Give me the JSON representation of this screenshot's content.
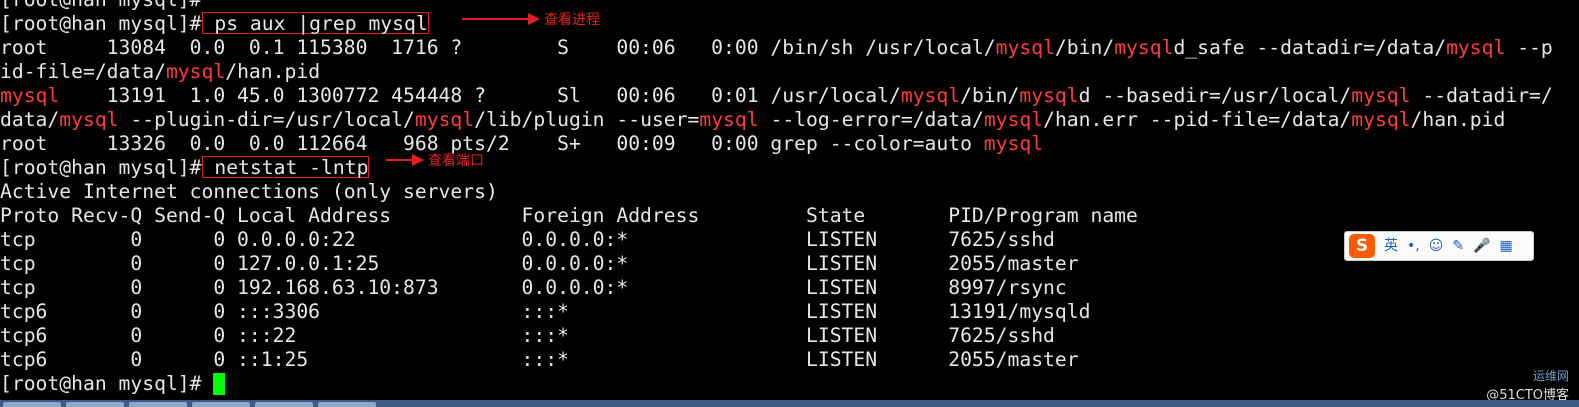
{
  "terminal": {
    "lines": [
      [
        {
          "t": "[root@han mysql]#",
          "c": ""
        }
      ],
      [
        {
          "t": "[root@han mysql]#",
          "c": ""
        },
        {
          "t": " ps aux |grep mysql",
          "c": "cmd"
        }
      ],
      [
        {
          "t": "root     13084  0.0  0.1 115380  1716 ?        S    00:06   0:00 /bin/sh /usr/local/",
          "c": ""
        },
        {
          "t": "mysql",
          "c": "red"
        },
        {
          "t": "/bin/",
          "c": ""
        },
        {
          "t": "mysql",
          "c": "red"
        },
        {
          "t": "d_safe --datadir=/data/",
          "c": ""
        },
        {
          "t": "mysql",
          "c": "red"
        },
        {
          "t": " --p",
          "c": ""
        }
      ],
      [
        {
          "t": "id-file=/data/",
          "c": ""
        },
        {
          "t": "mysql",
          "c": "red"
        },
        {
          "t": "/han.pid",
          "c": ""
        }
      ],
      [
        {
          "t": "mysql",
          "c": "red"
        },
        {
          "t": "    13191  1.0 45.0 1300772 454448 ?      Sl   00:06   0:01 /usr/local/",
          "c": ""
        },
        {
          "t": "mysql",
          "c": "red"
        },
        {
          "t": "/bin/",
          "c": ""
        },
        {
          "t": "mysql",
          "c": "red"
        },
        {
          "t": "d --basedir=/usr/local/",
          "c": ""
        },
        {
          "t": "mysql",
          "c": "red"
        },
        {
          "t": " --datadir=/",
          "c": ""
        }
      ],
      [
        {
          "t": "data/",
          "c": ""
        },
        {
          "t": "mysql",
          "c": "red"
        },
        {
          "t": " --plugin-dir=/usr/local/",
          "c": ""
        },
        {
          "t": "mysql",
          "c": "red"
        },
        {
          "t": "/lib/plugin --user=",
          "c": ""
        },
        {
          "t": "mysql",
          "c": "red"
        },
        {
          "t": " --log-error=/data/",
          "c": ""
        },
        {
          "t": "mysql",
          "c": "red"
        },
        {
          "t": "/han.err --pid-file=/data/",
          "c": ""
        },
        {
          "t": "mysql",
          "c": "red"
        },
        {
          "t": "/han.pid",
          "c": ""
        }
      ],
      [
        {
          "t": "root     13326  0.0  0.0 112664   968 pts/2    S+   00:09   0:00 grep --color=auto ",
          "c": ""
        },
        {
          "t": "mysql",
          "c": "red"
        }
      ],
      [
        {
          "t": "[root@han mysql]#",
          "c": ""
        },
        {
          "t": " netstat -lntp",
          "c": "cmd"
        }
      ],
      [
        {
          "t": "Active Internet connections (only servers)",
          "c": ""
        }
      ],
      [
        {
          "t": "Proto Recv-Q Send-Q Local Address           Foreign Address         State       PID/Program name",
          "c": ""
        }
      ],
      [
        {
          "t": "tcp        0      0 0.0.0.0:22              0.0.0.0:*               LISTEN      7625/sshd",
          "c": ""
        }
      ],
      [
        {
          "t": "tcp        0      0 127.0.0.1:25            0.0.0.0:*               LISTEN      2055/master",
          "c": ""
        }
      ],
      [
        {
          "t": "tcp        0      0 192.168.63.10:873       0.0.0.0:*               LISTEN      8997/rsync",
          "c": ""
        }
      ],
      [
        {
          "t": "tcp6       0      0 :::3306                 :::*                    LISTEN      13191/mysqld",
          "c": ""
        }
      ],
      [
        {
          "t": "tcp6       0      0 :::22                   :::*                    LISTEN      7625/sshd",
          "c": ""
        }
      ],
      [
        {
          "t": "tcp6       0      0 ::1:25                  :::*                    LISTEN      2055/master",
          "c": ""
        }
      ],
      [
        {
          "t": "[root@han mysql]# ",
          "c": ""
        }
      ]
    ]
  },
  "annotations": {
    "ps_label": "查看进程",
    "netstat_label": "查看端口"
  },
  "ime": {
    "logo": "S",
    "items": [
      "英",
      "•,",
      "☺",
      "✎",
      "🎤",
      "▦"
    ]
  },
  "watermark": {
    "top": "运维网",
    "bottom": "@51CTO博客"
  },
  "colors": {
    "background": "#000000",
    "text": "#e6e6e6",
    "highlight": "#ff3a3a",
    "annotation": "#e02020",
    "cursor": "#00ff00"
  }
}
